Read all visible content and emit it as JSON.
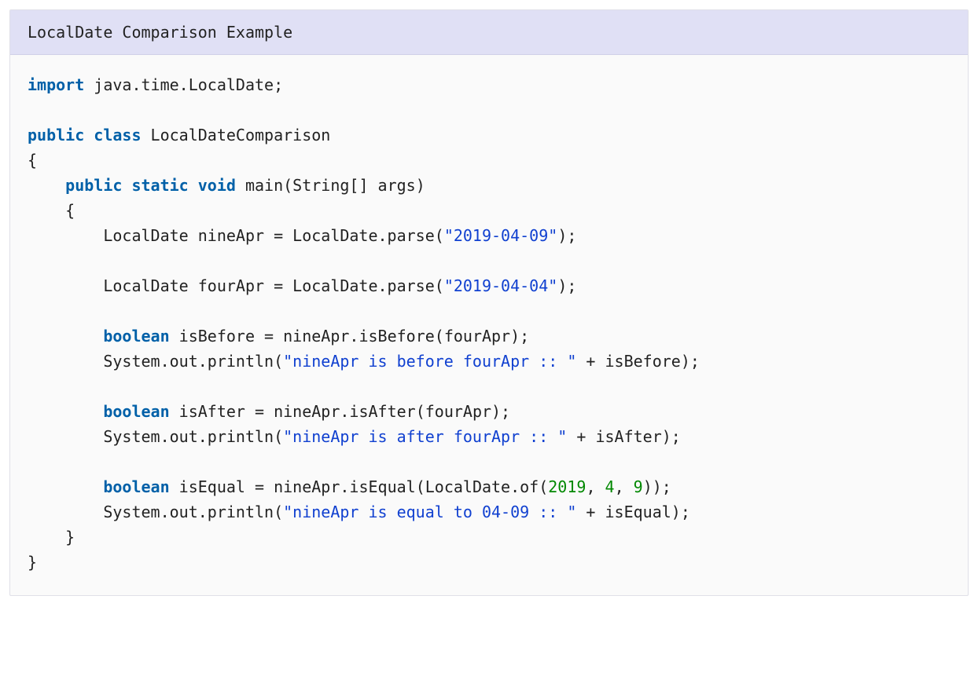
{
  "header": {
    "title": "LocalDate Comparison Example"
  },
  "code": {
    "tokens": [
      {
        "cls": "kw",
        "text": "import"
      },
      {
        "cls": "pln",
        "text": " java.time.LocalDate;\n\n"
      },
      {
        "cls": "kw",
        "text": "public"
      },
      {
        "cls": "pln",
        "text": " "
      },
      {
        "cls": "kw",
        "text": "class"
      },
      {
        "cls": "pln",
        "text": " LocalDateComparison\n{\n    "
      },
      {
        "cls": "kw",
        "text": "public"
      },
      {
        "cls": "pln",
        "text": " "
      },
      {
        "cls": "kw",
        "text": "static"
      },
      {
        "cls": "pln",
        "text": " "
      },
      {
        "cls": "kw",
        "text": "void"
      },
      {
        "cls": "pln",
        "text": " main(String[] args)\n    {\n        LocalDate nineApr = LocalDate.parse("
      },
      {
        "cls": "str",
        "text": "\"2019-04-09\""
      },
      {
        "cls": "pln",
        "text": ");\n\n        LocalDate fourApr = LocalDate.parse("
      },
      {
        "cls": "str",
        "text": "\"2019-04-04\""
      },
      {
        "cls": "pln",
        "text": ");\n\n        "
      },
      {
        "cls": "kw",
        "text": "boolean"
      },
      {
        "cls": "pln",
        "text": " isBefore = nineApr.isBefore(fourApr);\n        System.out.println("
      },
      {
        "cls": "str",
        "text": "\"nineApr is before fourApr :: \""
      },
      {
        "cls": "pln",
        "text": " + isBefore);\n\n        "
      },
      {
        "cls": "kw",
        "text": "boolean"
      },
      {
        "cls": "pln",
        "text": " isAfter = nineApr.isAfter(fourApr);\n        System.out.println("
      },
      {
        "cls": "str",
        "text": "\"nineApr is after fourApr :: \""
      },
      {
        "cls": "pln",
        "text": " + isAfter);\n\n        "
      },
      {
        "cls": "kw",
        "text": "boolean"
      },
      {
        "cls": "pln",
        "text": " isEqual = nineApr.isEqual(LocalDate.of("
      },
      {
        "cls": "num",
        "text": "2019"
      },
      {
        "cls": "pln",
        "text": ", "
      },
      {
        "cls": "num",
        "text": "4"
      },
      {
        "cls": "pln",
        "text": ", "
      },
      {
        "cls": "num",
        "text": "9"
      },
      {
        "cls": "pln",
        "text": "));\n        System.out.println("
      },
      {
        "cls": "str",
        "text": "\"nineApr is equal to 04-09 :: \""
      },
      {
        "cls": "pln",
        "text": " + isEqual);\n    }\n}"
      }
    ]
  }
}
